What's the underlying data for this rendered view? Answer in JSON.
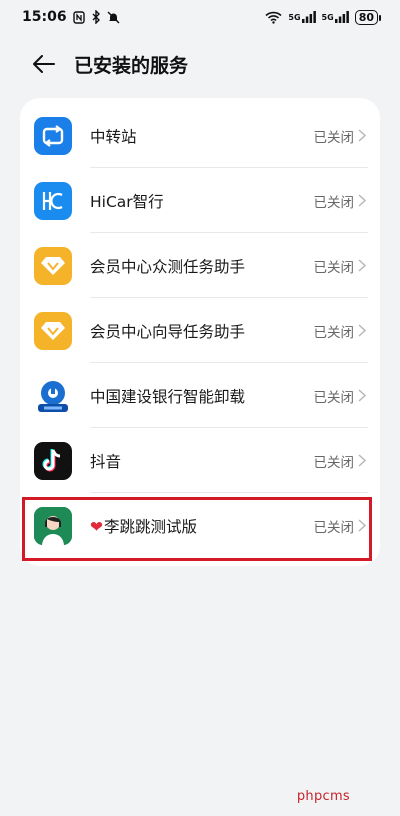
{
  "status_bar": {
    "time": "15:06",
    "signal1_label": "5G",
    "signal2_label": "5G",
    "battery": "80"
  },
  "header": {
    "title": "已安装的服务"
  },
  "services": [
    {
      "name": "中转站",
      "status": "已关闭",
      "icon": "transfer-icon"
    },
    {
      "name": "HiCar智行",
      "status": "已关闭",
      "icon": "hicar-icon"
    },
    {
      "name": "会员中心众测任务助手",
      "status": "已关闭",
      "icon": "member-diamond-icon"
    },
    {
      "name": "会员中心向导任务助手",
      "status": "已关闭",
      "icon": "member-diamond-icon"
    },
    {
      "name": "中国建设银行智能卸载",
      "status": "已关闭",
      "icon": "ccb-icon"
    },
    {
      "name": "抖音",
      "status": "已关闭",
      "icon": "douyin-icon"
    },
    {
      "name": "李跳跳测试版",
      "status": "已关闭",
      "icon": "lijumpjump-icon",
      "prefix": "❤"
    }
  ],
  "watermark": "phpcms",
  "colors": {
    "highlight": "#d41a26",
    "background": "#f1f3f5"
  }
}
